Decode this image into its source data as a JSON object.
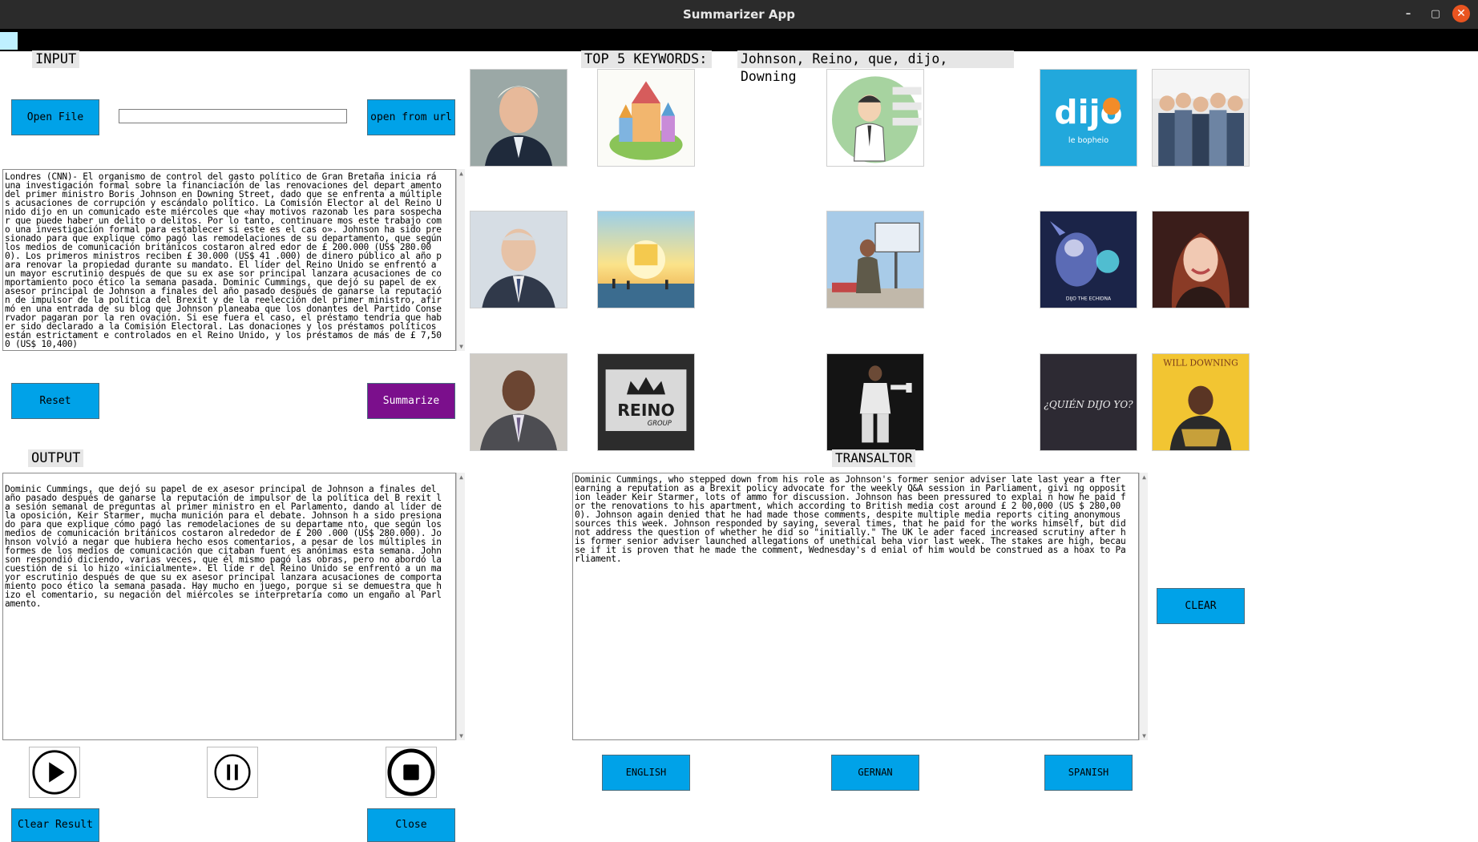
{
  "window": {
    "title": "Summarizer App"
  },
  "input": {
    "label": "INPUT",
    "open_file": "Open File",
    "open_url": "open from url",
    "url_value": "",
    "text": "Londres (CNN)- El organismo de control del gasto político de Gran Bretaña inicia rá una investigación formal sobre la financiación de las renovaciones del depart amento del primer ministro Boris Johnson en Downing Street, dado que se enfrenta a múltiples acusaciones de corrupción y escándalo político. La Comisión Elector al del Reino Unido dijo en un comunicado este miércoles que «hay motivos razonab les para sospechar que puede haber un delito o delitos. Por lo tanto, continuare mos este trabajo como una investigación formal para establecer si este es el cas o». Johnson ha sido presionado para que explique cómo pagó las remodelaciones de su departamento, que según los medios de comunicación británicos costaron alred edor de £ 200.000 (US$ 280.000). Los primeros ministros reciben £ 30.000 (US$ 41 .000) de dinero público al año para renovar la propiedad durante su mandato. El líder del Reino Unido se enfrentó a un mayor escrutinio después de que su ex ase sor principal lanzara acusaciones de comportamiento poco ético la semana pasada. Dominic Cummings, que dejó su papel de ex asesor principal de Johnson a finales del año pasado después de ganarse la reputación de impulsor de la política del Brexit y de la reelección del primer ministro, afirmó en una entrada de su blog que Johnson planeaba que los donantes del Partido Conservador pagaran por la ren ovación. Si ese fuera el caso, el préstamo tendría que haber sido declarado a la Comisión Electoral. Las donaciones y los préstamos políticos están estrictament e controlados en el Reino Unido, y los préstamos de más de £ 7,500 (US$ 10,400)",
    "reset": "Reset",
    "summarize": "Summarize"
  },
  "keywords": {
    "label": "TOP 5 KEYWORDS:",
    "value": "Johnson, Reino, que, dijo, Downing",
    "images": [
      "portrait-boris-johnson",
      "illustrated-fantasy-castle",
      "cartoon-confused-man",
      "dijo-logo",
      "group-photo",
      "portrait-older-man-suit",
      "golden-kingdom-painting",
      "person-with-billboard",
      "dijo-the-echidna-art",
      "portrait-woman-smiling",
      "portrait-man-dark-suit",
      "reino-group-logo",
      "person-standing-dark",
      "quien-dijo-yo-logo",
      "will-downing-album-cover"
    ],
    "image_text": {
      "dijo_logo": "dijo",
      "dijo_logo_sub": "le bopheio",
      "echidna_caption": "DIJO THE ECHIDNA",
      "reino_logo": "REINO",
      "reino_sub": "GROUP",
      "quien_dijo": "¿QUIÉN DIJO YO?",
      "will_downing": "WILL DOWNING"
    }
  },
  "output": {
    "label": "OUTPUT",
    "text": "Dominic Cummings, que dejó su papel de ex asesor principal de Johnson a finales del año pasado después de ganarse la reputación de impulsor de la política del B rexit la sesión semanal de preguntas al primer ministro en el Parlamento, dando al líder de la oposición, Keir Starmer, mucha munición para el debate. Johnson h a sido presionado para que explique cómo pagó las remodelaciones de su departame nto, que según los medios de comunicación británicos costaron alrededor de £ 200 .000 (US$ 280.000). Johnson volvió a negar que hubiera hecho esos comentarios, a pesar de los múltiples informes de los medios de comunicación que citaban fuent es anónimas esta semana. Johnson respondió diciendo, varias veces, que él mismo pagó las obras, pero no abordó la cuestión de si lo hizo «inicialmente». El líde r del Reino Unido se enfrentó a un mayor escrutinio después de que su ex asesor principal lanzara acusaciones de comportamiento poco ético la semana pasada. Hay mucho en juego, porque si se demuestra que hizo el comentario, su negación del miércoles se interpretaría como un engaño al Parlamento.",
    "clear_result": "Clear Result",
    "close": "Close"
  },
  "translator": {
    "label": "TRANSALTOR",
    "text": "Dominic Cummings, who stepped down from his role as Johnson's former senior adviser late last year a fter earning a reputation as a Brexit policy advocate for the weekly Q&A session in Parliament, givi ng opposition leader Keir Starmer, lots of ammo for discussion. Johnson has been pressured to explai n how he paid for the renovations to his apartment, which according to British media cost around £ 2 00,000 (US $ 280,000). Johnson again denied that he had made those comments, despite multiple media reports citing anonymous sources this week. Johnson responded by saying, several times, that he paid for the works himself, but did not address the question of whether he did so \"initially.\" The UK le ader faced increased scrutiny after his former senior adviser launched allegations of unethical beha vior last week. The stakes are high, because if it is proven that he made the comment, Wednesday's d enial of him would be construed as a hoax to Parliament.",
    "clear": "CLEAR",
    "english": "ENGLISH",
    "german": "GERNAN",
    "spanish": "SPANISH"
  },
  "colors": {
    "button": "#00a2e8",
    "summarize": "#7b0f8c",
    "titlebar": "#2b2b2b",
    "close_dot": "#e95420"
  }
}
